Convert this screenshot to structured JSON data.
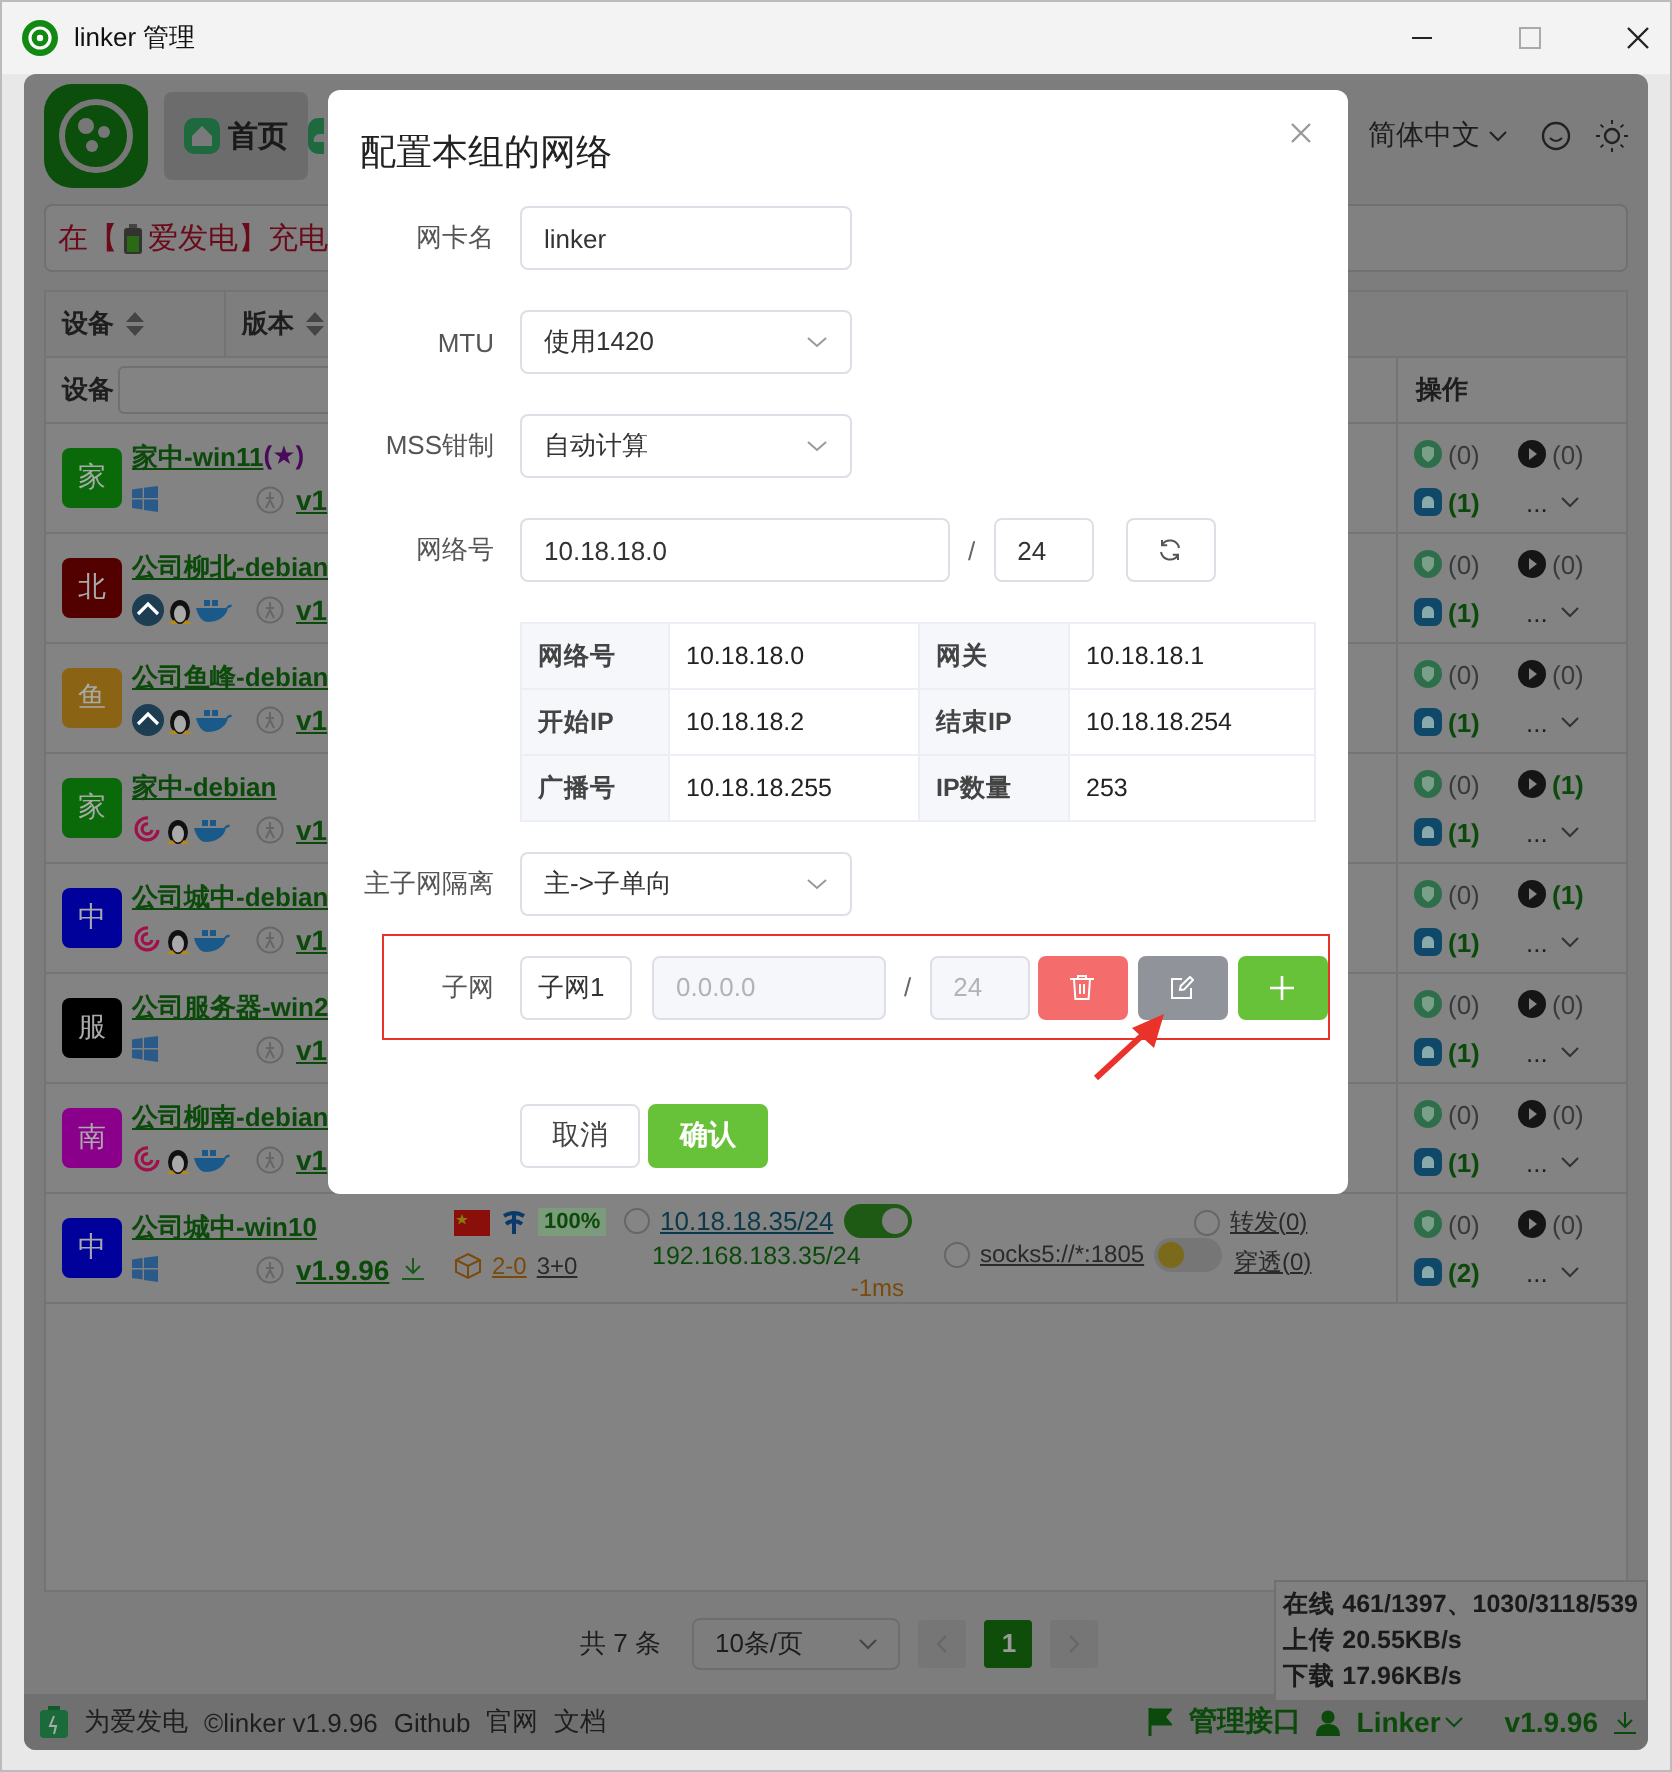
{
  "window": {
    "title": "linker 管理"
  },
  "header": {
    "tabs": [
      {
        "label": "首页",
        "selected": true
      },
      {
        "selected": false
      }
    ],
    "language": "简体中文"
  },
  "banner": {
    "prefix": "在【",
    "text": "爱发电】充电"
  },
  "table": {
    "sort_columns": [
      "设备",
      "版本"
    ],
    "filter_label": "设备",
    "ops_heading": "操作",
    "rows": [
      {
        "avatar": "家",
        "color": "#0a6a0a",
        "name": "家中-win11",
        "tag": "(★)",
        "os": [
          {
            "kind": "windows"
          }
        ],
        "version": "v1",
        "update": false,
        "ops": [
          {
            "kind": "shield",
            "count": "(0)",
            "active": false
          },
          {
            "kind": "play",
            "count": "(0)",
            "active": false
          },
          {
            "kind": "tunnel",
            "count": "(1)",
            "active": true
          }
        ],
        "more": "..."
      },
      {
        "avatar": "北",
        "color": "#520000",
        "name": "公司柳北-debian",
        "os": [
          {
            "kind": "openwrt"
          },
          {
            "kind": "linux"
          },
          {
            "kind": "docker"
          }
        ],
        "version": "v1",
        "update": false,
        "ops": [
          {
            "kind": "shield",
            "count": "(0)",
            "active": false
          },
          {
            "kind": "play",
            "count": "(0)",
            "active": false
          },
          {
            "kind": "tunnel",
            "count": "(1)",
            "active": true
          }
        ],
        "more": "..."
      },
      {
        "avatar": "鱼",
        "color": "#8a6414",
        "name": "公司鱼峰-debian",
        "os": [
          {
            "kind": "openwrt"
          },
          {
            "kind": "linux"
          },
          {
            "kind": "docker"
          }
        ],
        "version": "v1",
        "update": false,
        "ops": [
          {
            "kind": "shield",
            "count": "(0)",
            "active": false
          },
          {
            "kind": "play",
            "count": "(0)",
            "active": false
          },
          {
            "kind": "tunnel",
            "count": "(1)",
            "active": true
          }
        ],
        "more": "..."
      },
      {
        "avatar": "家",
        "color": "#0a6a0a",
        "name": "家中-debian",
        "os": [
          {
            "kind": "debian"
          },
          {
            "kind": "linux"
          },
          {
            "kind": "docker"
          }
        ],
        "version": "v1",
        "update": false,
        "ops": [
          {
            "kind": "shield",
            "count": "(0)",
            "active": false
          },
          {
            "kind": "play",
            "count": "(1)",
            "active": true
          },
          {
            "kind": "tunnel",
            "count": "(1)",
            "active": true
          }
        ],
        "more": "..."
      },
      {
        "avatar": "中",
        "color": "#00009a",
        "name": "公司城中-debian",
        "os": [
          {
            "kind": "debian"
          },
          {
            "kind": "linux"
          },
          {
            "kind": "docker"
          }
        ],
        "version": "v1",
        "update": false,
        "ops": [
          {
            "kind": "shield",
            "count": "(0)",
            "active": false
          },
          {
            "kind": "play",
            "count": "(1)",
            "active": true
          },
          {
            "kind": "tunnel",
            "count": "(1)",
            "active": true
          }
        ],
        "more": "..."
      },
      {
        "avatar": "服",
        "color": "#000000",
        "name": "公司服务器-win2",
        "os": [
          {
            "kind": "windows"
          }
        ],
        "version": "v1",
        "update": false,
        "ops": [
          {
            "kind": "shield",
            "count": "(0)",
            "active": false
          },
          {
            "kind": "play",
            "count": "(0)",
            "active": false
          },
          {
            "kind": "tunnel",
            "count": "(1)",
            "active": true
          }
        ],
        "more": "..."
      },
      {
        "avatar": "南",
        "color": "#8a008a",
        "name": "公司柳南-debian",
        "os": [
          {
            "kind": "debian"
          },
          {
            "kind": "linux"
          },
          {
            "kind": "docker"
          }
        ],
        "version": "v1",
        "update": false,
        "ops": [
          {
            "kind": "shield",
            "count": "(0)",
            "active": false
          },
          {
            "kind": "play",
            "count": "(0)",
            "active": false
          },
          {
            "kind": "tunnel",
            "count": "(1)",
            "active": true
          }
        ],
        "more": "..."
      },
      {
        "avatar": "中",
        "color": "#00009a",
        "name": "公司城中-win10",
        "os": [
          {
            "kind": "windows"
          }
        ],
        "version": "v1.9.96",
        "update": true,
        "details": {
          "signal": "100%",
          "ip": "10.18.18.35/24",
          "ip_selected": false,
          "ip_on": true,
          "lan_ip": "192.168.183.35/24",
          "relay": "2-0",
          "connections": "3+0",
          "latency": "-1ms",
          "socks": "socks5://*:1805",
          "socks_selected": false,
          "socks_on": false,
          "forward": "转发(0)",
          "forward_selected": false,
          "tunnel": "穿透(0)"
        },
        "ops": [
          {
            "kind": "shield",
            "count": "(0)",
            "active": false
          },
          {
            "kind": "play",
            "count": "(0)",
            "active": false
          },
          {
            "kind": "tunnel",
            "count": "(2)",
            "active": true
          }
        ],
        "more": "..."
      }
    ]
  },
  "pagination": {
    "total": "共 7 条",
    "page_size": "10条/页",
    "pages": [
      {
        "label": "1",
        "selected": true
      }
    ]
  },
  "stats": [
    "在线 461/1397、1030/3118/539",
    "上传 20.55KB/s",
    "下载 17.96KB/s"
  ],
  "footer": {
    "sponsor": "为爱发电",
    "links": [
      "©linker v1.9.96",
      "Github",
      "官网",
      "文档"
    ],
    "api": "管理接口",
    "user": "Linker",
    "version": "v1.9.96"
  },
  "modal": {
    "title": "配置本组的网络",
    "fields": [
      {
        "kind": "input",
        "label": "网卡名",
        "value": "linker"
      },
      {
        "kind": "select",
        "label": "MTU",
        "value": "使用1420"
      },
      {
        "kind": "select",
        "label": "MSS钳制",
        "value": "自动计算"
      },
      {
        "kind": "network",
        "label": "网络号",
        "value": "10.18.18.0",
        "separator": "/",
        "prefix": "24"
      },
      {
        "kind": "info",
        "cells": [
          {
            "label": "网络号",
            "value": "10.18.18.0"
          },
          {
            "label": "网关",
            "value": "10.18.18.1"
          },
          {
            "label": "开始IP",
            "value": "10.18.18.2"
          },
          {
            "label": "结束IP",
            "value": "10.18.18.254"
          },
          {
            "label": "广播号",
            "value": "10.18.18.255"
          },
          {
            "label": "IP数量",
            "value": "253"
          }
        ]
      },
      {
        "kind": "select",
        "label": "主子网隔离",
        "value": "主->子单向"
      },
      {
        "kind": "subnet",
        "label": "子网",
        "name": "子网1",
        "ip": "0.0.0.0",
        "separator": "/",
        "prefix": "24",
        "disabled": true,
        "highlighted": true
      }
    ],
    "cancel": "取消",
    "confirm": "确认"
  }
}
